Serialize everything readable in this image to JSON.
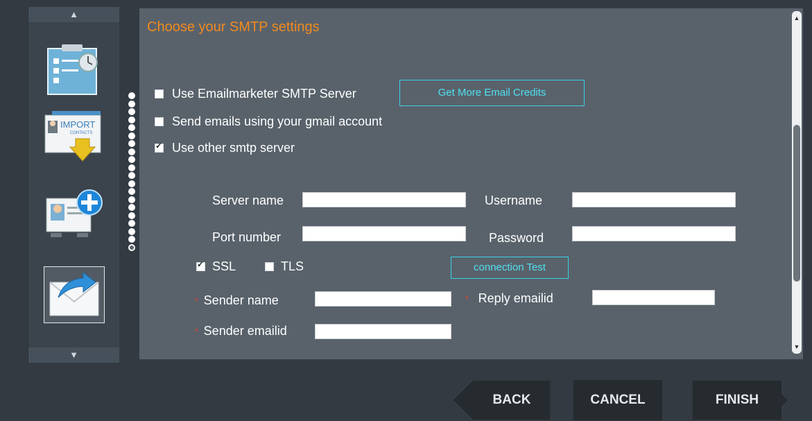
{
  "title": "Choose your SMTP settings",
  "options": [
    {
      "label": "Use Emailmarketer SMTP Server",
      "checked": false
    },
    {
      "label": "Send emails using your gmail account",
      "checked": false
    },
    {
      "label": "Use other smtp server",
      "checked": true
    }
  ],
  "get_credits_label": "Get More Email Credits",
  "server_name_label": "Server name",
  "username_label": "Username",
  "port_number_label": "Port number",
  "password_label": "Password",
  "ssl_label": "SSL",
  "tls_label": "TLS",
  "connection_test_label": "connection Test",
  "sender_name_label": "Sender name",
  "reply_emailid_label": "Reply emailid",
  "sender_emailid_label": "Sender emailid",
  "required_marker": "*",
  "fields": {
    "server_name": "",
    "username": "",
    "port_number": "",
    "password": "",
    "sender_name": "",
    "reply_emailid": "",
    "sender_emailid": ""
  },
  "nav": {
    "back": "BACK",
    "cancel": "CANCEL",
    "finish": "FINISH"
  },
  "sidebar": {
    "import_label": "IMPORT",
    "contacts_label": "CONTACTS"
  },
  "colors": {
    "accent_orange": "#f28a1e",
    "accent_cyan": "#36d4e8",
    "required_red": "#e53f2a"
  }
}
